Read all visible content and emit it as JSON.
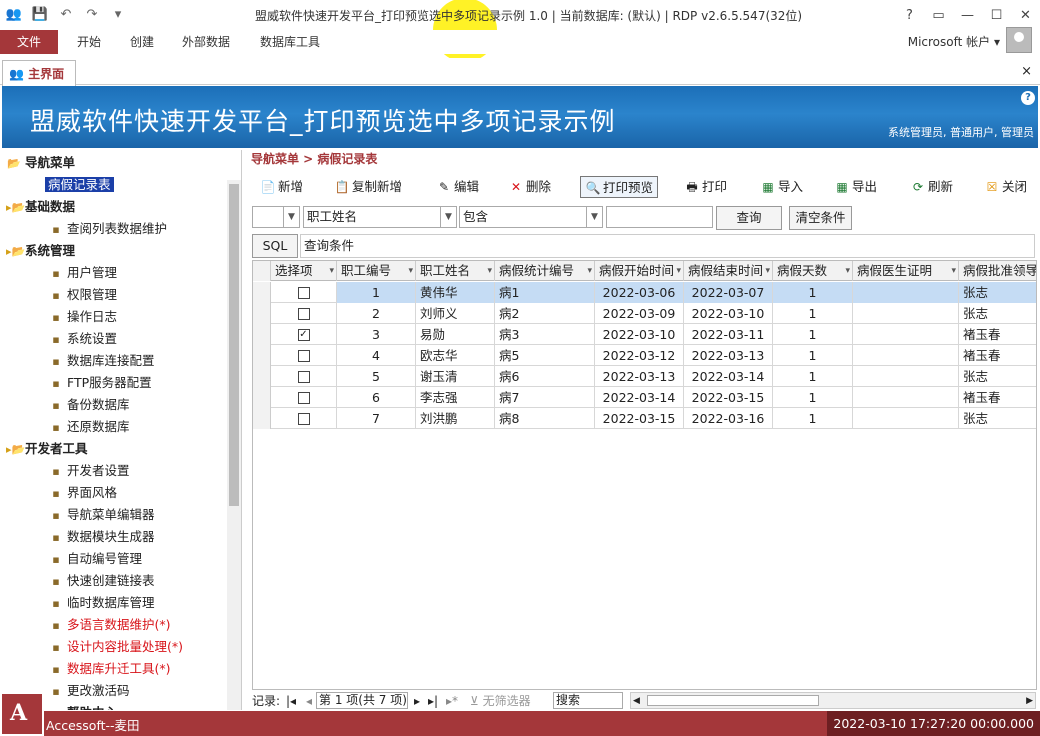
{
  "window": {
    "title": "盟威软件快速开发平台_打印预览选中多项记录示例 1.0 | 当前数据库: (默认) | RDP v2.6.5.547(32位)",
    "controls": [
      "?",
      "▭",
      "—",
      "☐",
      "✕"
    ]
  },
  "ribbon": {
    "file": "文件",
    "tabs": [
      "开始",
      "创建",
      "外部数据",
      "数据库工具"
    ],
    "account": "Microsoft 帐户"
  },
  "doc_tab": {
    "label": "主界面",
    "close": "×"
  },
  "banner": {
    "title": "盟威软件快速开发平台_打印预览选中多项记录示例",
    "user": "系统管理员, 普通用户, 管理员",
    "help": "?"
  },
  "nav": {
    "root": "导航菜单",
    "selected": "病假记录表",
    "groups": [
      {
        "label": "基础数据",
        "items": [
          "查阅列表数据维护"
        ]
      },
      {
        "label": "系统管理",
        "items": [
          "用户管理",
          "权限管理",
          "操作日志",
          "系统设置",
          "数据库连接配置",
          "FTP服务器配置",
          "备份数据库",
          "还原数据库"
        ]
      },
      {
        "label": "开发者工具",
        "items": [
          "开发者设置",
          "界面风格",
          "导航菜单编辑器",
          "数据模块生成器",
          "自动编号管理",
          "快速创建链接表",
          "临时数据库管理",
          "多语言数据维护(*)",
          "设计内容批量处理(*)",
          "数据库升迁工具(*)",
          "更改激活码"
        ]
      }
    ],
    "partial_item": "帮助中心"
  },
  "breadcrumb": "导航菜单 > 病假记录表",
  "toolbar": {
    "new": "新增",
    "copy_new": "复制新增",
    "edit": "编辑",
    "delete": "删除",
    "print_preview": "打印预览",
    "print": "打印",
    "import": "导入",
    "export": "导出",
    "refresh": "刷新",
    "close": "关闭"
  },
  "filter": {
    "field": "职工姓名",
    "operator": "包含",
    "value": "",
    "search": "查询",
    "clear": "清空条件",
    "sql": "SQL",
    "query_label": "查询条件"
  },
  "grid": {
    "columns": [
      "选择项",
      "职工编号",
      "职工姓名",
      "病假统计编号",
      "病假开始时间",
      "病假结束时间",
      "病假天数",
      "病假医生证明",
      "病假批准领导"
    ],
    "rows": [
      {
        "checked": false,
        "id": "1",
        "name": "黄伟华",
        "code": "病1",
        "start": "2022-03-06",
        "end": "2022-03-07",
        "days": "1",
        "doctor": "",
        "approver": "张志"
      },
      {
        "checked": false,
        "id": "2",
        "name": "刘师义",
        "code": "病2",
        "start": "2022-03-09",
        "end": "2022-03-10",
        "days": "1",
        "doctor": "",
        "approver": "张志"
      },
      {
        "checked": true,
        "id": "3",
        "name": "易勋",
        "code": "病3",
        "start": "2022-03-10",
        "end": "2022-03-11",
        "days": "1",
        "doctor": "",
        "approver": "褚玉春"
      },
      {
        "checked": false,
        "id": "4",
        "name": "欧志华",
        "code": "病5",
        "start": "2022-03-12",
        "end": "2022-03-13",
        "days": "1",
        "doctor": "",
        "approver": "褚玉春"
      },
      {
        "checked": false,
        "id": "5",
        "name": "谢玉清",
        "code": "病6",
        "start": "2022-03-13",
        "end": "2022-03-14",
        "days": "1",
        "doctor": "",
        "approver": "张志"
      },
      {
        "checked": false,
        "id": "6",
        "name": "李志强",
        "code": "病7",
        "start": "2022-03-14",
        "end": "2022-03-15",
        "days": "1",
        "doctor": "",
        "approver": "褚玉春"
      },
      {
        "checked": false,
        "id": "7",
        "name": "刘洪鹏",
        "code": "病8",
        "start": "2022-03-15",
        "end": "2022-03-16",
        "days": "1",
        "doctor": "",
        "approver": "张志"
      }
    ]
  },
  "record_nav": {
    "label": "记录:",
    "position": "第 1 项(共 7 项)",
    "no_filter": "无筛选器",
    "search": "搜索"
  },
  "status": {
    "left": "Accessoft--麦田",
    "right": "2022-03-10 17:27:20 00:00.000"
  },
  "colors": {
    "accent": "#a4373a",
    "banner": "#1c6fb8",
    "selection": "#1b3fa8",
    "row_highlight": "#c5dcf4",
    "red_item": "#d8141a"
  }
}
